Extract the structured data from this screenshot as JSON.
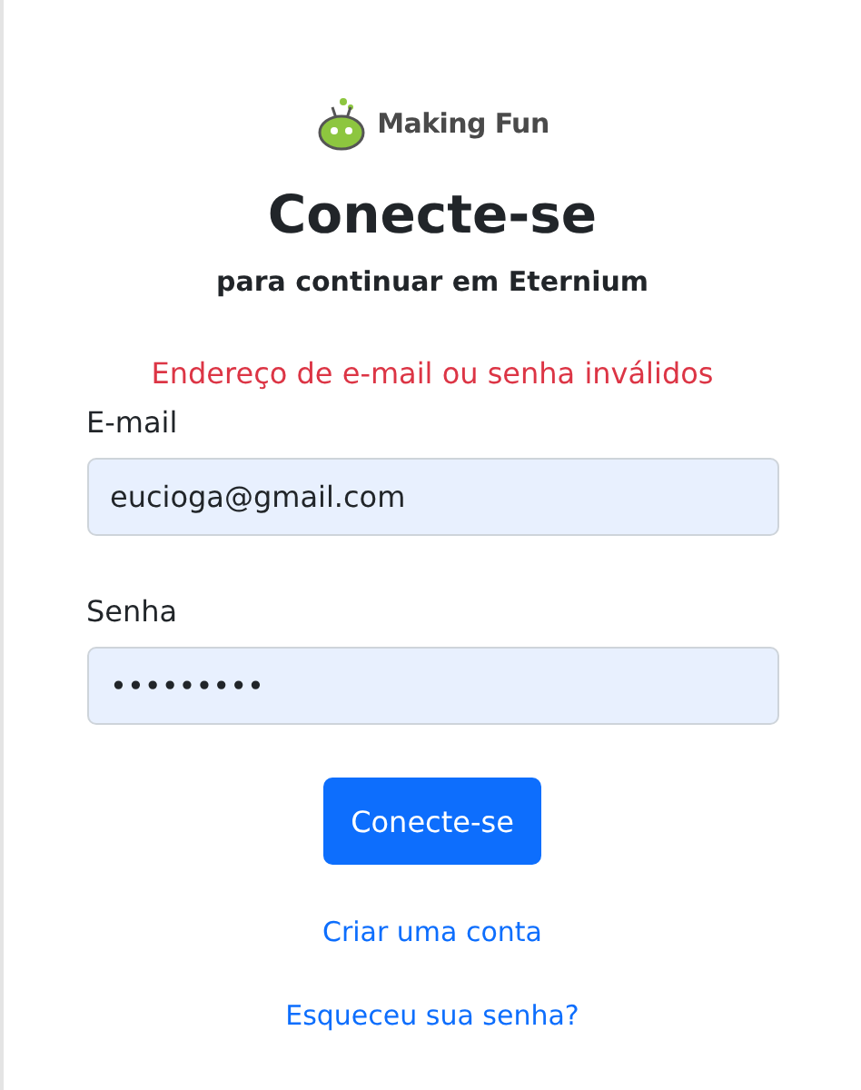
{
  "logo": {
    "text": "Making Fun"
  },
  "title": "Conecte-se",
  "subtitle": "para continuar em Eternium",
  "error": "Endereço de e-mail ou senha inválidos",
  "fields": [
    {
      "label": "E-mail",
      "value": "eucioga@gmail.com"
    },
    {
      "label": "Senha",
      "value": "•••••••••"
    }
  ],
  "submit": "Conecte-se",
  "links": [
    "Criar uma conta",
    "Esqueceu sua senha?"
  ]
}
